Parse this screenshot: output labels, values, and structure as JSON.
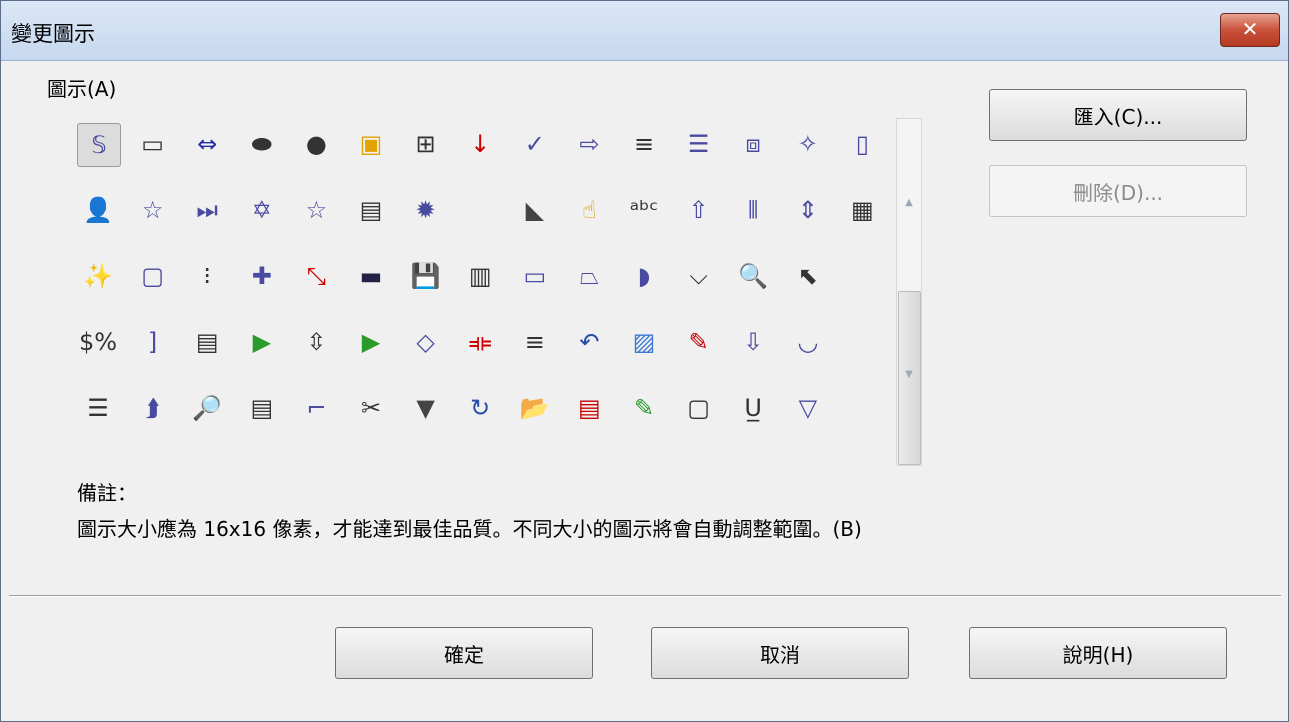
{
  "window": {
    "title": "變更圖示",
    "close_glyph": "✕"
  },
  "icons_label": "圖示(A)",
  "icons": [
    [
      {
        "name": "scroll-doc-icon",
        "glyph": "𝕊",
        "color": "#4a4aa0"
      },
      {
        "name": "form-field-icon",
        "glyph": "▭",
        "color": "#333"
      },
      {
        "name": "circle-arrow-icon",
        "glyph": "⇔",
        "color": "#2a2aa8"
      },
      {
        "name": "octagon-icon",
        "glyph": "⬬",
        "color": "#333"
      },
      {
        "name": "filled-circle-icon",
        "glyph": "●",
        "color": "#333"
      },
      {
        "name": "image-frame-icon",
        "glyph": "▣",
        "color": "#e2a400"
      },
      {
        "name": "table-icon",
        "glyph": "⊞",
        "color": "#333"
      },
      {
        "name": "sort-za-icon",
        "glyph": "↓",
        "color": "#c00"
      },
      {
        "name": "spellcheck-icon",
        "glyph": "✓",
        "color": "#4a4aa0"
      },
      {
        "name": "right-arrow-icon",
        "glyph": "⇨",
        "color": "#4a4aa0"
      },
      {
        "name": "align-justify-icon",
        "glyph": "≡",
        "color": "#333"
      },
      {
        "name": "align-lines-icon",
        "glyph": "☰",
        "color": "#4a4aa0"
      },
      {
        "name": "frame-icon",
        "glyph": "⧈",
        "color": "#4a4aa0"
      },
      {
        "name": "star4-icon",
        "glyph": "✧",
        "color": "#4a4aa0"
      },
      {
        "name": "page-rect-icon",
        "glyph": "▯",
        "color": "#4a4aa0"
      }
    ],
    [
      {
        "name": "user-edit-icon",
        "glyph": "👤",
        "color": "#4a4aa0"
      },
      {
        "name": "star-outline-icon",
        "glyph": "☆",
        "color": "#4a4aa0"
      },
      {
        "name": "media-next-icon",
        "glyph": "⏭",
        "color": "#4a4aa0"
      },
      {
        "name": "star6-icon",
        "glyph": "✡",
        "color": "#4a4aa0"
      },
      {
        "name": "star-small-icon",
        "glyph": "☆",
        "color": "#4a4aa0"
      },
      {
        "name": "calendar-icon",
        "glyph": "▤",
        "color": "#333"
      },
      {
        "name": "burst-icon",
        "glyph": "✹",
        "color": "#4a4aa0"
      },
      {
        "name": "blank-icon",
        "glyph": "",
        "color": "#333"
      },
      {
        "name": "diagonal-shape-icon",
        "glyph": "◣",
        "color": "#444"
      },
      {
        "name": "hand-yellow-icon",
        "glyph": "☝",
        "color": "#d0a000"
      },
      {
        "name": "abc-icon",
        "glyph": "ᵃᵇᶜ",
        "color": "#333"
      },
      {
        "name": "up-arrow-icon",
        "glyph": "⇧",
        "color": "#4a4aa0"
      },
      {
        "name": "column-sep-icon",
        "glyph": "⫴",
        "color": "#4a4aa0"
      },
      {
        "name": "field-size-icon",
        "glyph": "⇕",
        "color": "#4a4aa0"
      },
      {
        "name": "list-box-icon",
        "glyph": "▦",
        "color": "#333"
      }
    ],
    [
      {
        "name": "magic-wand-icon",
        "glyph": "✨",
        "color": "#333"
      },
      {
        "name": "rounded-rect-icon",
        "glyph": "▢",
        "color": "#4a4aa0"
      },
      {
        "name": "slider-icon",
        "glyph": "⁝",
        "color": "#333"
      },
      {
        "name": "cross-icon",
        "glyph": "✚",
        "color": "#4a4aa0"
      },
      {
        "name": "connector-icon",
        "glyph": "⤡",
        "color": "#c00"
      },
      {
        "name": "bar-icon",
        "glyph": "▬",
        "color": "#224"
      },
      {
        "name": "save-icon",
        "glyph": "💾",
        "color": "#4a4aa0"
      },
      {
        "name": "doc-columns-icon",
        "glyph": "▥",
        "color": "#333"
      },
      {
        "name": "rect-icon",
        "glyph": "▭",
        "color": "#4a4aa0"
      },
      {
        "name": "trapezoid-icon",
        "glyph": "⏢",
        "color": "#4a4aa0"
      },
      {
        "name": "gauge-icon",
        "glyph": "◗",
        "color": "#4a4aa0"
      },
      {
        "name": "chevron-icon",
        "glyph": "⌵",
        "color": "#333"
      },
      {
        "name": "zoom-page-icon",
        "glyph": "🔍",
        "color": "#333"
      },
      {
        "name": "cursor-icon",
        "glyph": "⬉",
        "color": "#333"
      },
      {
        "name": "empty-cell-icon",
        "glyph": "",
        "color": "#333"
      }
    ],
    [
      {
        "name": "currency-icon",
        "glyph": "$%",
        "color": "#333"
      },
      {
        "name": "bracket-icon",
        "glyph": "]",
        "color": "#4a4aa0"
      },
      {
        "name": "doc-list-icon",
        "glyph": "▤",
        "color": "#333"
      },
      {
        "name": "play-sun-icon",
        "glyph": "▶",
        "color": "#2a9a2a"
      },
      {
        "name": "spin-icon",
        "glyph": "⇳",
        "color": "#333"
      },
      {
        "name": "play-box-icon",
        "glyph": "▶",
        "color": "#2a9a2a"
      },
      {
        "name": "diamond-icon",
        "glyph": "◇",
        "color": "#4a4aa0"
      },
      {
        "name": "distribute-icon",
        "glyph": "⟚",
        "color": "#c00"
      },
      {
        "name": "align-center-icon",
        "glyph": "≡",
        "color": "#333"
      },
      {
        "name": "undo-arrow-icon",
        "glyph": "↶",
        "color": "#2a4aa8"
      },
      {
        "name": "landscape-image-icon",
        "glyph": "▨",
        "color": "#3a7ad0"
      },
      {
        "name": "compass-icon",
        "glyph": "✎",
        "color": "#c00"
      },
      {
        "name": "down-arrow-icon",
        "glyph": "⇩",
        "color": "#4a4aa0"
      },
      {
        "name": "arc-icon",
        "glyph": "◡",
        "color": "#4a4aa0"
      },
      {
        "name": "empty-cell-icon",
        "glyph": "",
        "color": "#333"
      }
    ],
    [
      {
        "name": "numbered-list-icon",
        "glyph": "☰",
        "color": "#333"
      },
      {
        "name": "split-arrow-icon",
        "glyph": "⮭",
        "color": "#4a4aa0"
      },
      {
        "name": "zoom-people-icon",
        "glyph": "🔎",
        "color": "#2a9a2a"
      },
      {
        "name": "paragraph-icon",
        "glyph": "▤",
        "color": "#333"
      },
      {
        "name": "scroll-shape-icon",
        "glyph": "⌐",
        "color": "#4a4aa0"
      },
      {
        "name": "cut-icon",
        "glyph": "✂",
        "color": "#333"
      },
      {
        "name": "down-triangle-icon",
        "glyph": "▼",
        "color": "#444"
      },
      {
        "name": "rotate-icon",
        "glyph": "↻",
        "color": "#2a4aa8"
      },
      {
        "name": "open-folder-icon",
        "glyph": "📂",
        "color": "#d0a000"
      },
      {
        "name": "pdf-icon",
        "glyph": "▤",
        "color": "#c00"
      },
      {
        "name": "pencil-icon",
        "glyph": "✎",
        "color": "#2a9a2a"
      },
      {
        "name": "ole-object-icon",
        "glyph": "▢",
        "color": "#333"
      },
      {
        "name": "underline-icon",
        "glyph": "U̲",
        "color": "#333"
      },
      {
        "name": "triangle-outline-icon",
        "glyph": "▽",
        "color": "#4a4aa0"
      },
      {
        "name": "empty-cell-icon",
        "glyph": "",
        "color": "#333"
      }
    ]
  ],
  "note": {
    "heading": "備註：",
    "text": "圖示大小應為 16x16 像素，才能達到最佳品質。不同大小的圖示將會自動調整範圍。(B)"
  },
  "buttons": {
    "import": "匯入(C)...",
    "delete": "刪除(D)...",
    "ok": "確定",
    "cancel": "取消",
    "help": "說明(H)"
  }
}
